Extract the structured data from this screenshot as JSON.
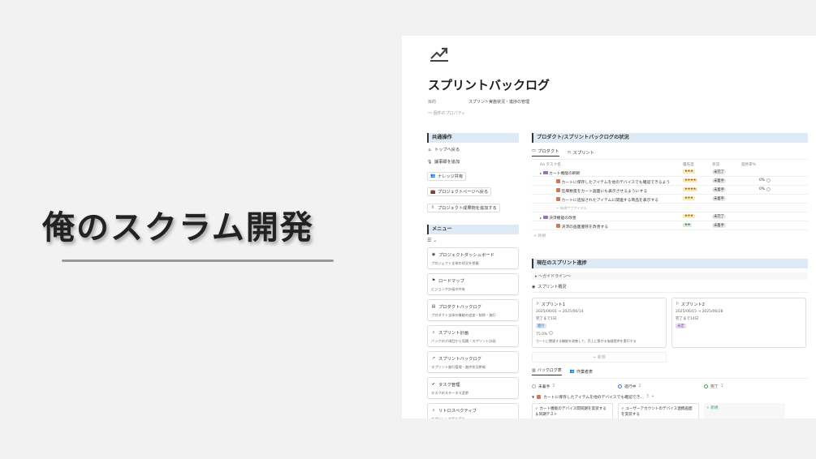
{
  "hero": {
    "title": "俺のスクラム開発"
  },
  "page": {
    "title": "スプリントバックログ",
    "prop_label": "目的",
    "prop_value": "スプリント実施状況・進捗の管理",
    "more_props": "〜 個件のプロパティ"
  },
  "left": {
    "common_ops_title": "共通操作",
    "links": [
      {
        "icon": "home-icon",
        "glyph": "⌂",
        "label": "トップへ戻る",
        "boxed": false
      },
      {
        "icon": "mic-icon",
        "glyph": "🎙",
        "label": "議事録を追加",
        "boxed": false
      },
      {
        "icon": "people-icon",
        "glyph": "👥",
        "label": "ナレッジ共有",
        "boxed": true
      },
      {
        "icon": "briefcase-icon",
        "glyph": "💼",
        "label": "プロジェクトページへ戻る",
        "boxed": true
      },
      {
        "icon": "upload-icon",
        "glyph": "⇪",
        "label": "プロジェクト成果物を追加する",
        "boxed": true
      }
    ],
    "menu_title": "メニュー",
    "menu_cards": [
      {
        "icon": "dashboard-icon",
        "glyph": "◉",
        "title": "プロジェクトダッシュボード",
        "sub": "プロジェクト全体の状況を把握"
      },
      {
        "icon": "roadmap-icon",
        "glyph": "⚑",
        "title": "ロードマップ",
        "sub": "ビジョンや計画の共有"
      },
      {
        "icon": "backlog-icon",
        "glyph": "▤",
        "title": "プロダクトバックログ",
        "sub": "プロダクト全体の機能の追加・削除・進行"
      },
      {
        "icon": "sprint-plan-icon",
        "glyph": "⌕",
        "title": "スプリント計画",
        "sub": "バックログ項目から見積・スプリント計画"
      },
      {
        "icon": "chart-icon",
        "glyph": "↗",
        "title": "スプリントバックログ",
        "sub": "スプリント進行管理・進捗状況更新"
      },
      {
        "icon": "task-icon",
        "glyph": "✔",
        "title": "タスク管理",
        "sub": "タスクのステータス変更"
      },
      {
        "icon": "retro-icon",
        "glyph": "⌕",
        "title": "リトロスペクティブ",
        "sub": "スプリントの振り返り"
      }
    ]
  },
  "right": {
    "backlog_title": "プロダクト/スプリントバックログの状況",
    "tabs": [
      "プロダクト",
      "スプリント"
    ],
    "headers": {
      "task": "Aa タスク名",
      "priority": "優先度",
      "status": "状況",
      "progress": "進捗率%"
    },
    "rows": [
      {
        "kind": "group",
        "name": "カート機能の刷新",
        "priority": "★★★",
        "status": "未完了"
      },
      {
        "kind": "item",
        "name": "カートに保存したアイテムを他のデバイスでも確認できるよう",
        "priority": "★★★★",
        "status": "未着手",
        "progress": "0%"
      },
      {
        "kind": "item",
        "name": "在庫数量をカート画面にも表示させるようにする",
        "priority": "★★★★",
        "status": "未着手",
        "progress": "0%"
      },
      {
        "kind": "item",
        "name": "カートに追加されたアイテムに関連する商品を表示する",
        "priority": "★★★",
        "status": "未着手",
        "progress": ""
      },
      {
        "kind": "addsub",
        "name": "新規サブアイテム"
      },
      {
        "kind": "group",
        "name": "決済機能の改善",
        "priority": "★★★",
        "status": "未完了"
      },
      {
        "kind": "item",
        "name": "決済の画面遷移を改善する",
        "priority": "★★",
        "status": "未着手",
        "progress": "",
        "green": true
      }
    ],
    "new_label": "+ 新規",
    "sprint_title": "現在のスプリント進捗",
    "guideline": "▸ 〜ガイドライン〜",
    "sprint_tab": "スプリント概況",
    "sprints": [
      {
        "name": "スプリント1",
        "dates": "2025/06/01 → 2025/06/14",
        "done": "完了まで1日",
        "tag": "進行",
        "pct": "75.0%",
        "goal": "カートに関連する機能を改善して、売上に繋がる価値提供を実行する"
      },
      {
        "name": "スプリント2",
        "dates": "2025/06/15 → 2025/06/28",
        "done": "完了まで14日",
        "tag": "未定"
      }
    ],
    "new_card": "+ 新規",
    "board_tabs": [
      "バックログ表",
      "作業者表"
    ],
    "columns": [
      {
        "name": "未着手",
        "count": "2"
      },
      {
        "name": "進行中",
        "count": "2"
      },
      {
        "name": "完了",
        "count": "1"
      }
    ],
    "group_name": "カートに保存したアイテムを他のデバイスでも確認でき...",
    "group_count": "3",
    "bcards": [
      "カート機能のデバイス間同期を実装する＆同期テスト",
      "ユーザーアカウントのデバイス連携画面を実装する",
      "+ 新規"
    ]
  }
}
